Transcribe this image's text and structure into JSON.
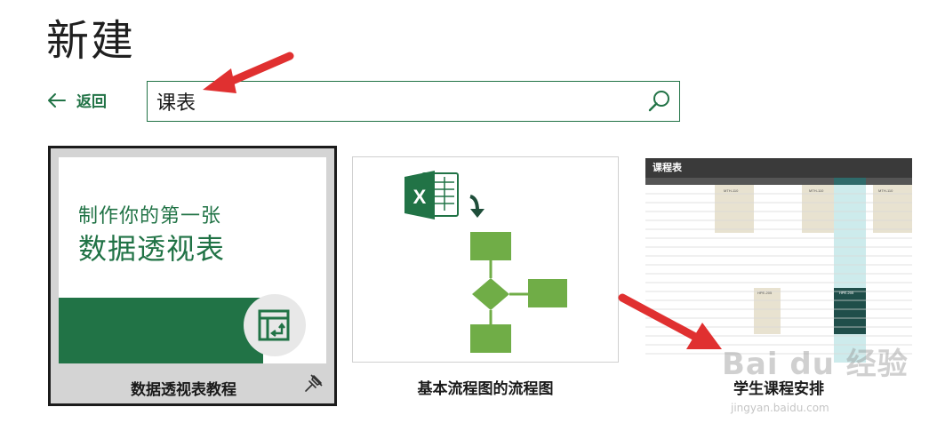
{
  "page": {
    "title": "新建"
  },
  "nav": {
    "back_label": "返回"
  },
  "search": {
    "value": "课表",
    "placeholder": ""
  },
  "templates": [
    {
      "label": "数据透视表教程",
      "thumb_text_line1": "制作你的第一张",
      "thumb_text_line2": "数据透视表",
      "pinned_icon": "pin-icon"
    },
    {
      "label": "基本流程图的流程图"
    },
    {
      "label": "学生课程安排",
      "thumb_title": "课程表",
      "thumb_cells": [
        "MTH-110",
        "MTH-110",
        "MTH-110",
        "HPE-205",
        "HPE-205"
      ]
    }
  ],
  "watermark": {
    "text": "Bai du 经验",
    "url": "jingyan.baidu.com"
  },
  "colors": {
    "accent": "#217346",
    "flow_green": "#70AD47",
    "schedule_tan": "#E8E2D0",
    "schedule_teal": "#CDEBEC",
    "schedule_dark": "#1F4E4A",
    "annotation_red": "#E03030"
  },
  "icons": [
    "back-arrow-icon",
    "search-icon",
    "pin-icon",
    "excel-icon",
    "pivot-table-icon"
  ]
}
